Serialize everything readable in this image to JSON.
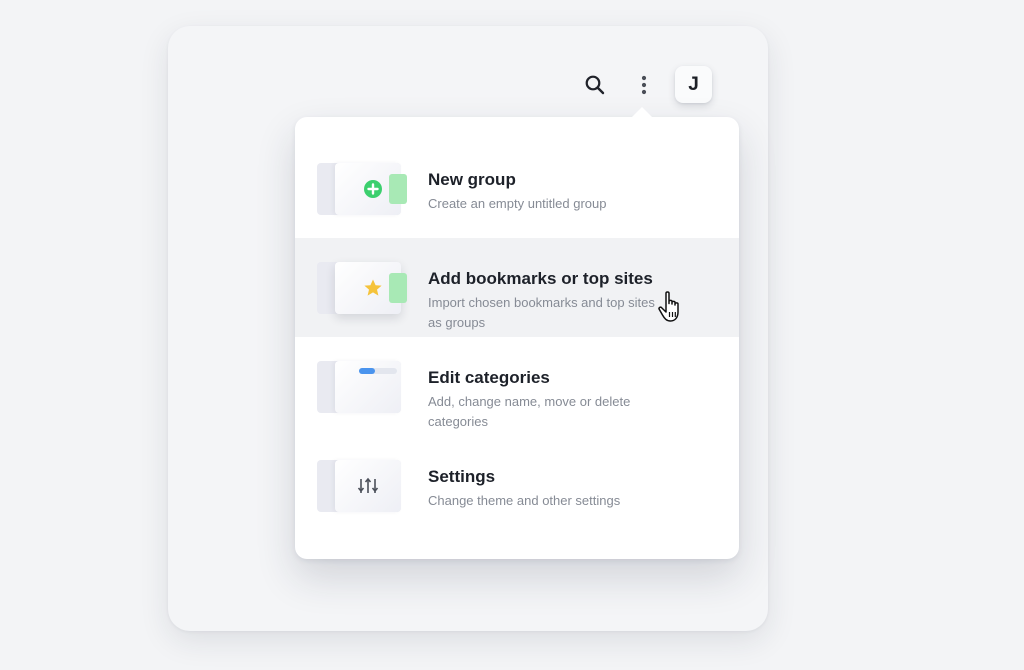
{
  "header": {
    "avatar_initial": "J",
    "icons": [
      "search-icon",
      "more-vertical-icon"
    ]
  },
  "menu": {
    "items": [
      {
        "title": "New group",
        "description": "Create an empty untitled group",
        "icon": "plus-circle-icon",
        "hovered": false
      },
      {
        "title": "Add bookmarks or top sites",
        "description": "Import chosen bookmarks and top sites as groups",
        "icon": "star-icon",
        "hovered": true
      },
      {
        "title": "Edit categories",
        "description": "Add, change name, move or delete categories",
        "icon": "category-bar-icon",
        "hovered": false
      },
      {
        "title": "Settings",
        "description": "Change theme and other settings",
        "icon": "sliders-icon",
        "hovered": false
      }
    ]
  },
  "colors": {
    "accent_green": "#3ccf6e",
    "card_green": "#a8e9b5",
    "star_yellow": "#f5c33b",
    "accent_blue": "#4a94ee",
    "hover_bg": "#f1f2f4"
  }
}
